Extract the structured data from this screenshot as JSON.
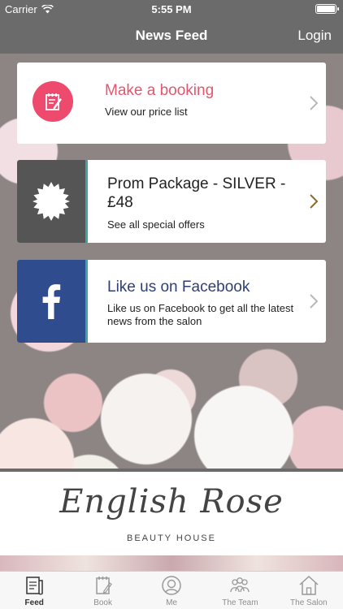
{
  "status_bar": {
    "carrier": "Carrier",
    "time": "5:55 PM"
  },
  "nav": {
    "title": "News Feed",
    "login": "Login"
  },
  "cards": {
    "booking": {
      "title": "Make a booking",
      "subtitle": "View our price list"
    },
    "prom": {
      "title": "Prom Package - SILVER - £48",
      "subtitle": "See all special offers"
    },
    "facebook": {
      "title": "Like us on Facebook",
      "subtitle": "Like us on Facebook to get all the latest news from the salon"
    }
  },
  "logo": {
    "name": "English Rose",
    "tagline": "BEAUTY HOUSE"
  },
  "tabs": [
    {
      "label": "Feed",
      "icon": "feed-icon"
    },
    {
      "label": "Book",
      "icon": "book-icon"
    },
    {
      "label": "Me",
      "icon": "me-icon"
    },
    {
      "label": "The Team",
      "icon": "team-icon"
    },
    {
      "label": "The Salon",
      "icon": "salon-icon"
    }
  ],
  "colors": {
    "accent_pink": "#ee4a6d",
    "facebook_blue": "#2e4c8e",
    "teal_divider": "#3aa7a0",
    "bar_gray": "#6b6b6b"
  }
}
